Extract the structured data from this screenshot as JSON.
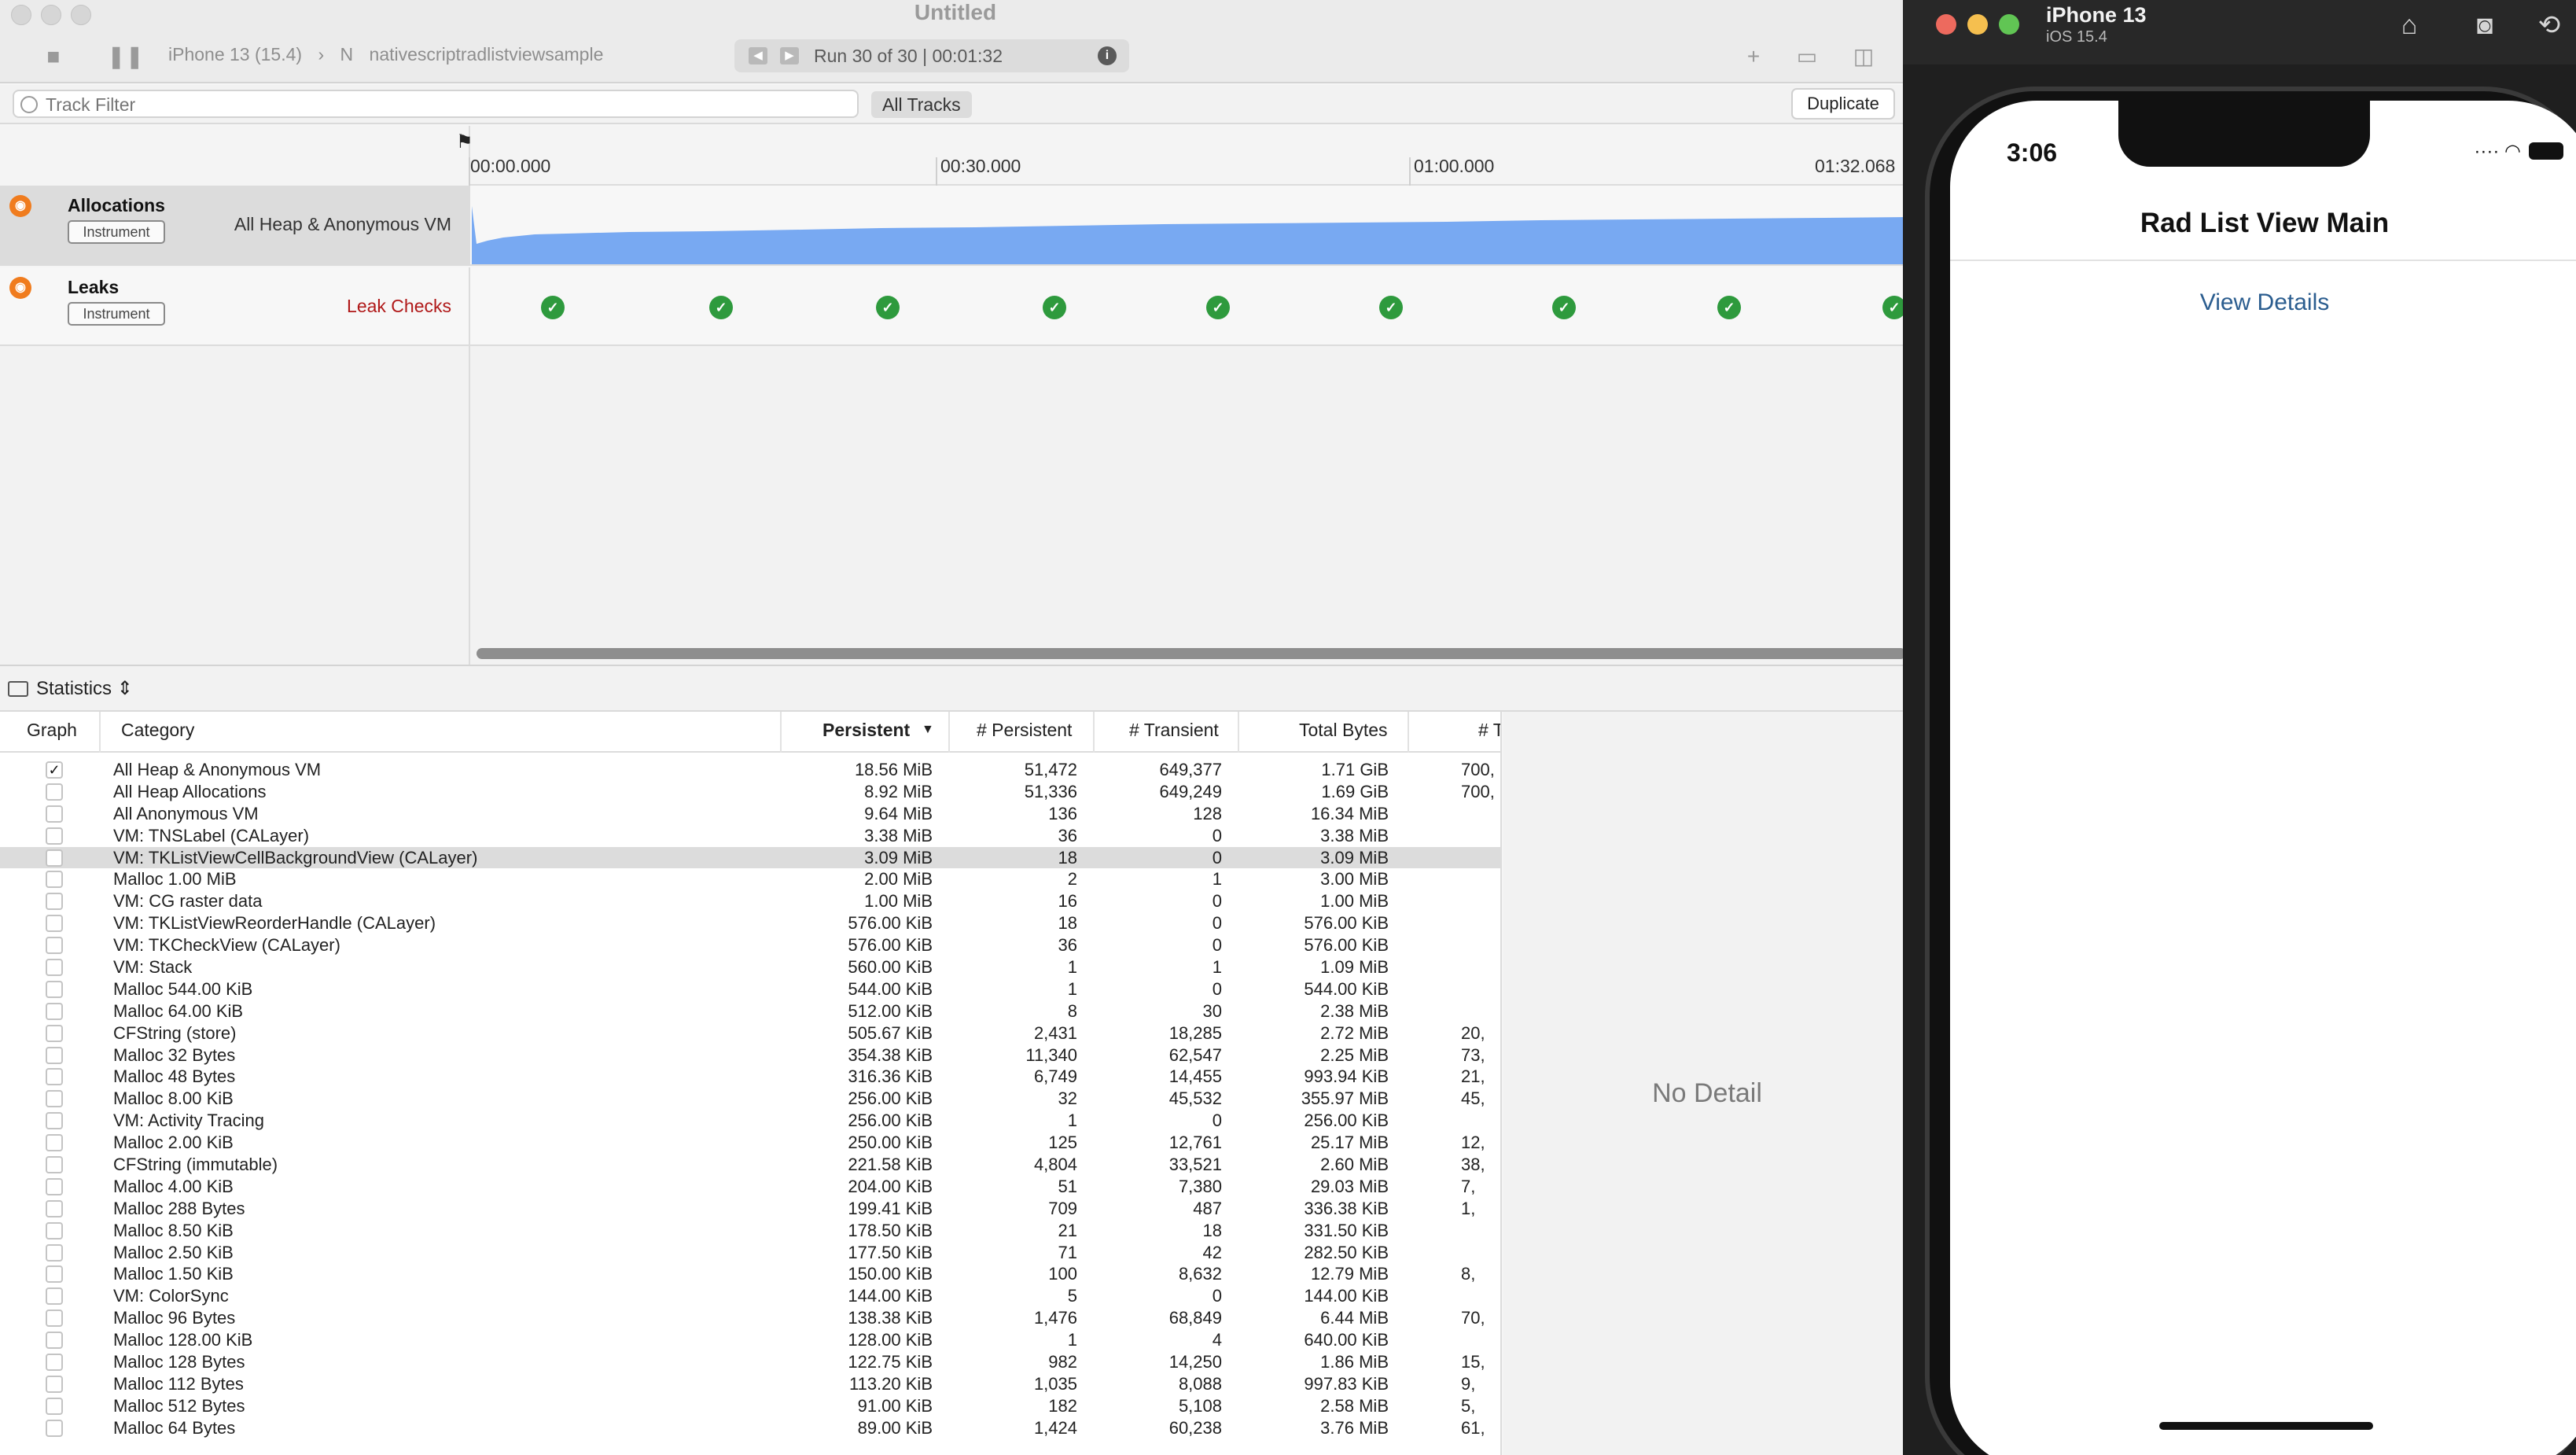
{
  "window": {
    "title": "Untitled"
  },
  "toolbar": {
    "device": "iPhone 13 (15.4)",
    "target": "nativescriptradlistviewsample",
    "run": "Run 30 of 30  |  00:01:32",
    "info_label": "i"
  },
  "filterbar": {
    "placeholder": "Track Filter",
    "all_tracks": "All Tracks",
    "duplicate": "Duplicate"
  },
  "ruler": {
    "ticks": [
      "00:00.000",
      "00:30.000",
      "01:00.000",
      "01:32.068"
    ]
  },
  "tracks": [
    {
      "name": "Allocations",
      "tag": "Instrument",
      "subtitle": "All Heap & Anonymous VM"
    },
    {
      "name": "Leaks",
      "tag": "Instrument",
      "subtitle": "Leak Checks"
    }
  ],
  "allocation_graph": {
    "color": "#78a9f2"
  },
  "leak_checks": {
    "count": 9,
    "status": "ok"
  },
  "stats": {
    "label": "Statistics",
    "columns": [
      "Graph",
      "Category",
      "Persistent",
      "# Persistent",
      "# Transient",
      "Total Bytes",
      "# T"
    ],
    "rows": [
      {
        "checked": true,
        "cat": "All Heap & Anonymous VM",
        "p": "18.56 MiB",
        "np": "51,472",
        "nt": "649,377",
        "tb": "1.71 GiB",
        "t": "700,"
      },
      {
        "checked": false,
        "cat": "All Heap Allocations",
        "p": "8.92 MiB",
        "np": "51,336",
        "nt": "649,249",
        "tb": "1.69 GiB",
        "t": "700,"
      },
      {
        "checked": false,
        "cat": "All Anonymous VM",
        "p": "9.64 MiB",
        "np": "136",
        "nt": "128",
        "tb": "16.34 MiB",
        "t": ""
      },
      {
        "checked": false,
        "cat": "VM: TNSLabel (CALayer)",
        "p": "3.38 MiB",
        "np": "36",
        "nt": "0",
        "tb": "3.38 MiB",
        "t": ""
      },
      {
        "checked": false,
        "cat": "VM: TKListViewCellBackgroundView (CALayer)",
        "p": "3.09 MiB",
        "np": "18",
        "nt": "0",
        "tb": "3.09 MiB",
        "t": "",
        "highlight": true
      },
      {
        "checked": false,
        "cat": "Malloc 1.00 MiB",
        "p": "2.00 MiB",
        "np": "2",
        "nt": "1",
        "tb": "3.00 MiB",
        "t": ""
      },
      {
        "checked": false,
        "cat": "VM: CG raster data",
        "p": "1.00 MiB",
        "np": "16",
        "nt": "0",
        "tb": "1.00 MiB",
        "t": ""
      },
      {
        "checked": false,
        "cat": "VM: TKListViewReorderHandle (CALayer)",
        "p": "576.00 KiB",
        "np": "18",
        "nt": "0",
        "tb": "576.00 KiB",
        "t": ""
      },
      {
        "checked": false,
        "cat": "VM: TKCheckView (CALayer)",
        "p": "576.00 KiB",
        "np": "36",
        "nt": "0",
        "tb": "576.00 KiB",
        "t": ""
      },
      {
        "checked": false,
        "cat": "VM: Stack",
        "p": "560.00 KiB",
        "np": "1",
        "nt": "1",
        "tb": "1.09 MiB",
        "t": ""
      },
      {
        "checked": false,
        "cat": "Malloc 544.00 KiB",
        "p": "544.00 KiB",
        "np": "1",
        "nt": "0",
        "tb": "544.00 KiB",
        "t": ""
      },
      {
        "checked": false,
        "cat": "Malloc 64.00 KiB",
        "p": "512.00 KiB",
        "np": "8",
        "nt": "30",
        "tb": "2.38 MiB",
        "t": ""
      },
      {
        "checked": false,
        "cat": "CFString (store)",
        "p": "505.67 KiB",
        "np": "2,431",
        "nt": "18,285",
        "tb": "2.72 MiB",
        "t": "20,"
      },
      {
        "checked": false,
        "cat": "Malloc 32 Bytes",
        "p": "354.38 KiB",
        "np": "11,340",
        "nt": "62,547",
        "tb": "2.25 MiB",
        "t": "73,"
      },
      {
        "checked": false,
        "cat": "Malloc 48 Bytes",
        "p": "316.36 KiB",
        "np": "6,749",
        "nt": "14,455",
        "tb": "993.94 KiB",
        "t": "21,"
      },
      {
        "checked": false,
        "cat": "Malloc 8.00 KiB",
        "p": "256.00 KiB",
        "np": "32",
        "nt": "45,532",
        "tb": "355.97 MiB",
        "t": "45,"
      },
      {
        "checked": false,
        "cat": "VM: Activity Tracing",
        "p": "256.00 KiB",
        "np": "1",
        "nt": "0",
        "tb": "256.00 KiB",
        "t": ""
      },
      {
        "checked": false,
        "cat": "Malloc 2.00 KiB",
        "p": "250.00 KiB",
        "np": "125",
        "nt": "12,761",
        "tb": "25.17 MiB",
        "t": "12,"
      },
      {
        "checked": false,
        "cat": "CFString (immutable)",
        "p": "221.58 KiB",
        "np": "4,804",
        "nt": "33,521",
        "tb": "2.60 MiB",
        "t": "38,"
      },
      {
        "checked": false,
        "cat": "Malloc 4.00 KiB",
        "p": "204.00 KiB",
        "np": "51",
        "nt": "7,380",
        "tb": "29.03 MiB",
        "t": "7,"
      },
      {
        "checked": false,
        "cat": "Malloc 288 Bytes",
        "p": "199.41 KiB",
        "np": "709",
        "nt": "487",
        "tb": "336.38 KiB",
        "t": "1,"
      },
      {
        "checked": false,
        "cat": "Malloc 8.50 KiB",
        "p": "178.50 KiB",
        "np": "21",
        "nt": "18",
        "tb": "331.50 KiB",
        "t": ""
      },
      {
        "checked": false,
        "cat": "Malloc 2.50 KiB",
        "p": "177.50 KiB",
        "np": "71",
        "nt": "42",
        "tb": "282.50 KiB",
        "t": ""
      },
      {
        "checked": false,
        "cat": "Malloc 1.50 KiB",
        "p": "150.00 KiB",
        "np": "100",
        "nt": "8,632",
        "tb": "12.79 MiB",
        "t": "8,"
      },
      {
        "checked": false,
        "cat": "VM: ColorSync",
        "p": "144.00 KiB",
        "np": "5",
        "nt": "0",
        "tb": "144.00 KiB",
        "t": ""
      },
      {
        "checked": false,
        "cat": "Malloc 96 Bytes",
        "p": "138.38 KiB",
        "np": "1,476",
        "nt": "68,849",
        "tb": "6.44 MiB",
        "t": "70,"
      },
      {
        "checked": false,
        "cat": "Malloc 128.00 KiB",
        "p": "128.00 KiB",
        "np": "1",
        "nt": "4",
        "tb": "640.00 KiB",
        "t": ""
      },
      {
        "checked": false,
        "cat": "Malloc 128 Bytes",
        "p": "122.75 KiB",
        "np": "982",
        "nt": "14,250",
        "tb": "1.86 MiB",
        "t": "15,"
      },
      {
        "checked": false,
        "cat": "Malloc 112 Bytes",
        "p": "113.20 KiB",
        "np": "1,035",
        "nt": "8,088",
        "tb": "997.83 KiB",
        "t": "9,"
      },
      {
        "checked": false,
        "cat": "Malloc 512 Bytes",
        "p": "91.00 KiB",
        "np": "182",
        "nt": "5,108",
        "tb": "2.58 MiB",
        "t": "5,"
      },
      {
        "checked": false,
        "cat": "Malloc 64 Bytes",
        "p": "89.00 KiB",
        "np": "1,424",
        "nt": "60,238",
        "tb": "3.76 MiB",
        "t": "61,"
      }
    ]
  },
  "detail": {
    "empty_text": "No Detail"
  },
  "simulator": {
    "device_name": "iPhone 13",
    "os": "iOS 15.4",
    "time": "3:06",
    "nav_title": "Rad List View Main",
    "button": "View Details"
  }
}
